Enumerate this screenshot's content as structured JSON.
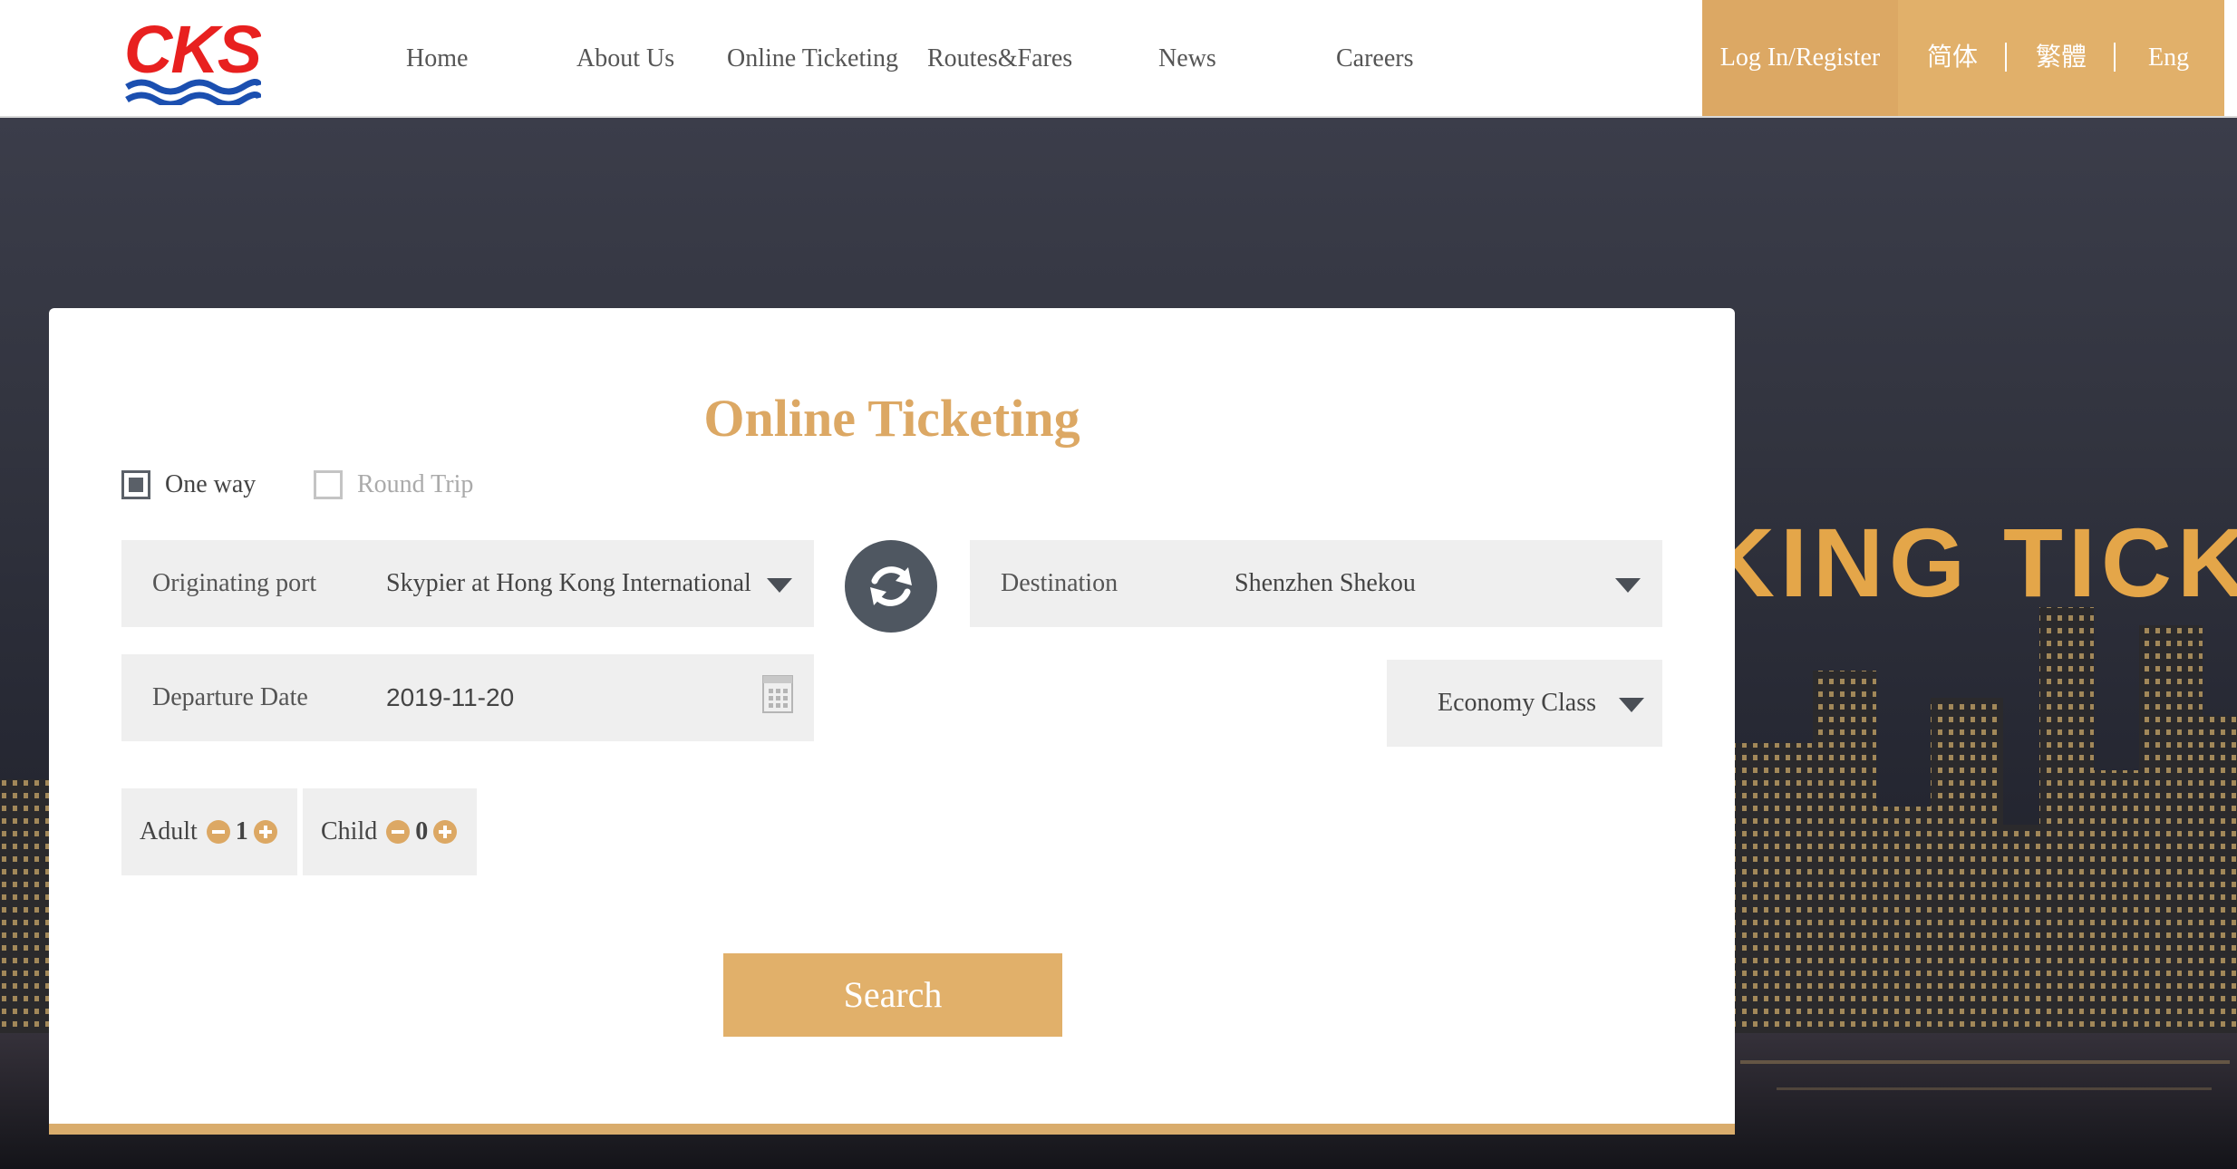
{
  "header": {
    "logo_text": "CKS",
    "nav": [
      "Home",
      "About Us",
      "Online Ticketing",
      "Routes&Fares",
      "News",
      "Careers"
    ],
    "login_label": "Log In/Register",
    "languages": [
      "简体",
      "繁體",
      "Eng"
    ]
  },
  "hero": {
    "banner_text": "KING TICKE"
  },
  "booking": {
    "title": "Online Ticketing",
    "trip_types": [
      {
        "label": "One way",
        "checked": true
      },
      {
        "label": "Round Trip",
        "checked": false
      }
    ],
    "origin": {
      "label": "Originating port",
      "value": "Skypier at Hong Kong International"
    },
    "destination": {
      "label": "Destination",
      "value": "Shenzhen Shekou"
    },
    "departure": {
      "label": "Departure Date",
      "value": "2019-11-20"
    },
    "class": {
      "value": "Economy Class"
    },
    "adult": {
      "label": "Adult",
      "count": "1"
    },
    "child": {
      "label": "Child",
      "count": "0"
    },
    "search_label": "Search"
  },
  "colors": {
    "accent": "#e1b06a",
    "title": "#dca864",
    "field_bg": "#efefef",
    "swap_bg": "#4f5761",
    "logo_red": "#e8201f",
    "logo_blue": "#1b4fb0"
  },
  "icons": [
    "swap-icon",
    "caret-down-icon",
    "calendar-icon",
    "minus-icon",
    "plus-icon"
  ]
}
